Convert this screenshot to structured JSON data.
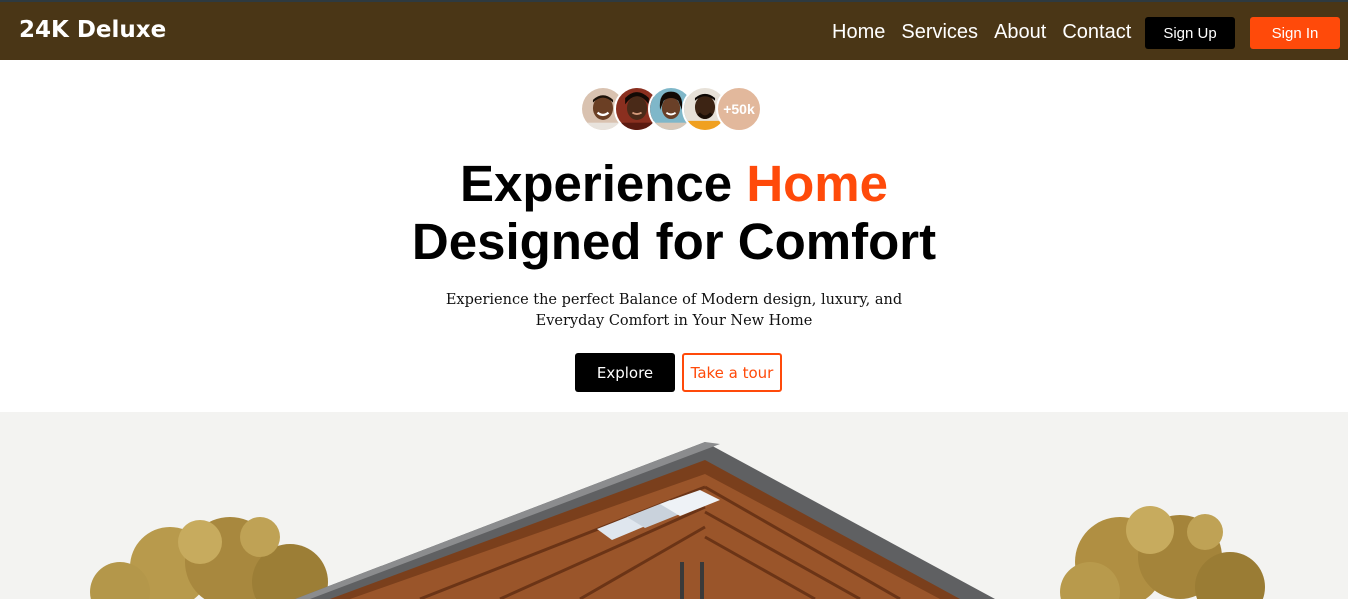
{
  "brand": {
    "name": "24K Deluxe"
  },
  "nav": {
    "links": [
      "Home",
      "Services",
      "About",
      "Contact"
    ],
    "signup_label": "Sign Up",
    "signin_label": "Sign In"
  },
  "social_proof": {
    "count_label": "+50k",
    "avatars": [
      "avatar-1",
      "avatar-2",
      "avatar-3",
      "avatar-4"
    ]
  },
  "hero": {
    "title_part1": "Experience ",
    "title_accent": "Home",
    "title_line2": "Designed for Comfort",
    "subtitle_line1": "Experience the perfect Balance of Modern design, luxury, and",
    "subtitle_line2": "Everyday Comfort in Your New Home",
    "explore_label": "Explore",
    "tour_label": "Take a tour"
  },
  "colors": {
    "navbar_bg": "#4a3616",
    "accent": "#ff4a0a",
    "primary_button": "#000000"
  }
}
